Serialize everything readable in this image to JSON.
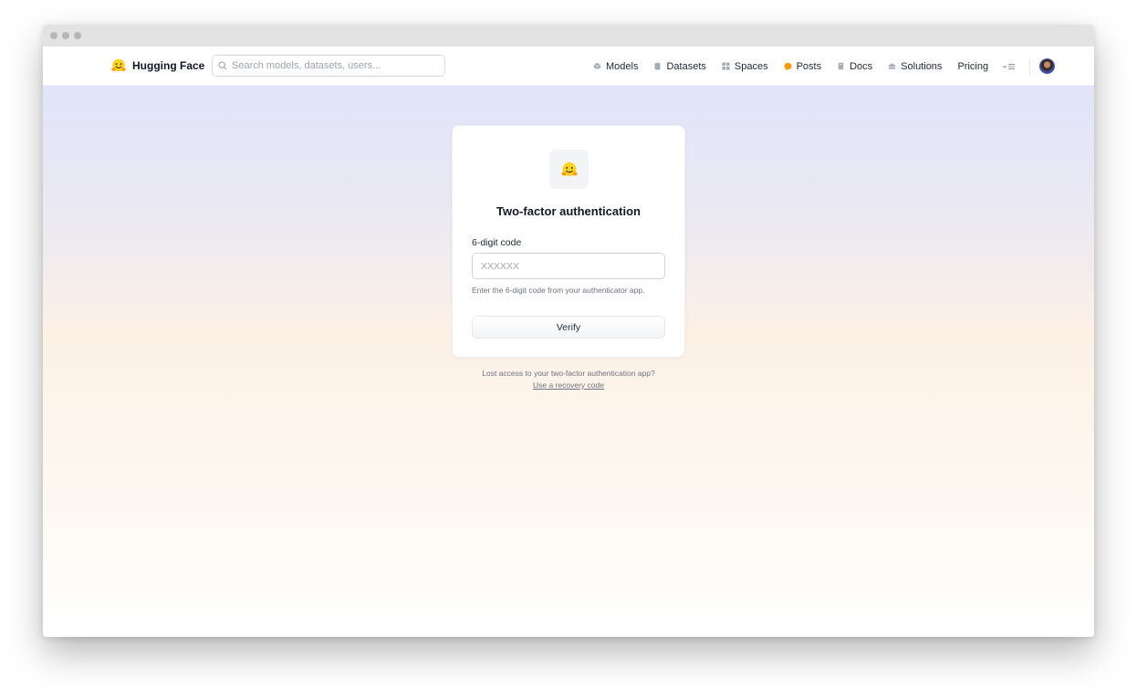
{
  "window": {
    "controls": [
      "close",
      "minimize",
      "maximize"
    ]
  },
  "navbar": {
    "brand": "Hugging Face",
    "search_placeholder": "Search models, datasets, users...",
    "links": [
      {
        "label": "Models",
        "icon": "cube-icon",
        "color": "#9ca3af"
      },
      {
        "label": "Datasets",
        "icon": "database-icon",
        "color": "#9ca3af"
      },
      {
        "label": "Spaces",
        "icon": "grid-icon",
        "color": "#9ca3af"
      },
      {
        "label": "Posts",
        "icon": "chat-bubble-icon",
        "color": "#f59e0b"
      },
      {
        "label": "Docs",
        "icon": "book-icon",
        "color": "#9ca3af"
      },
      {
        "label": "Solutions",
        "icon": "building-icon",
        "color": "#9ca3af"
      },
      {
        "label": "Pricing",
        "icon": "",
        "color": ""
      }
    ],
    "more_icon": "menu-icon"
  },
  "card": {
    "title": "Two-factor authentication",
    "field_label": "6-digit code",
    "input_placeholder": "XXXXXX",
    "input_value": "",
    "helper_text": "Enter the 6-digit code from your authenticator app.",
    "button_label": "Verify"
  },
  "recovery": {
    "prompt": "Lost access to your two-factor authentication app?",
    "link_label": "Use a recovery code"
  },
  "colors": {
    "brand_yellow": "#ffd21e",
    "accent": "#111827"
  }
}
